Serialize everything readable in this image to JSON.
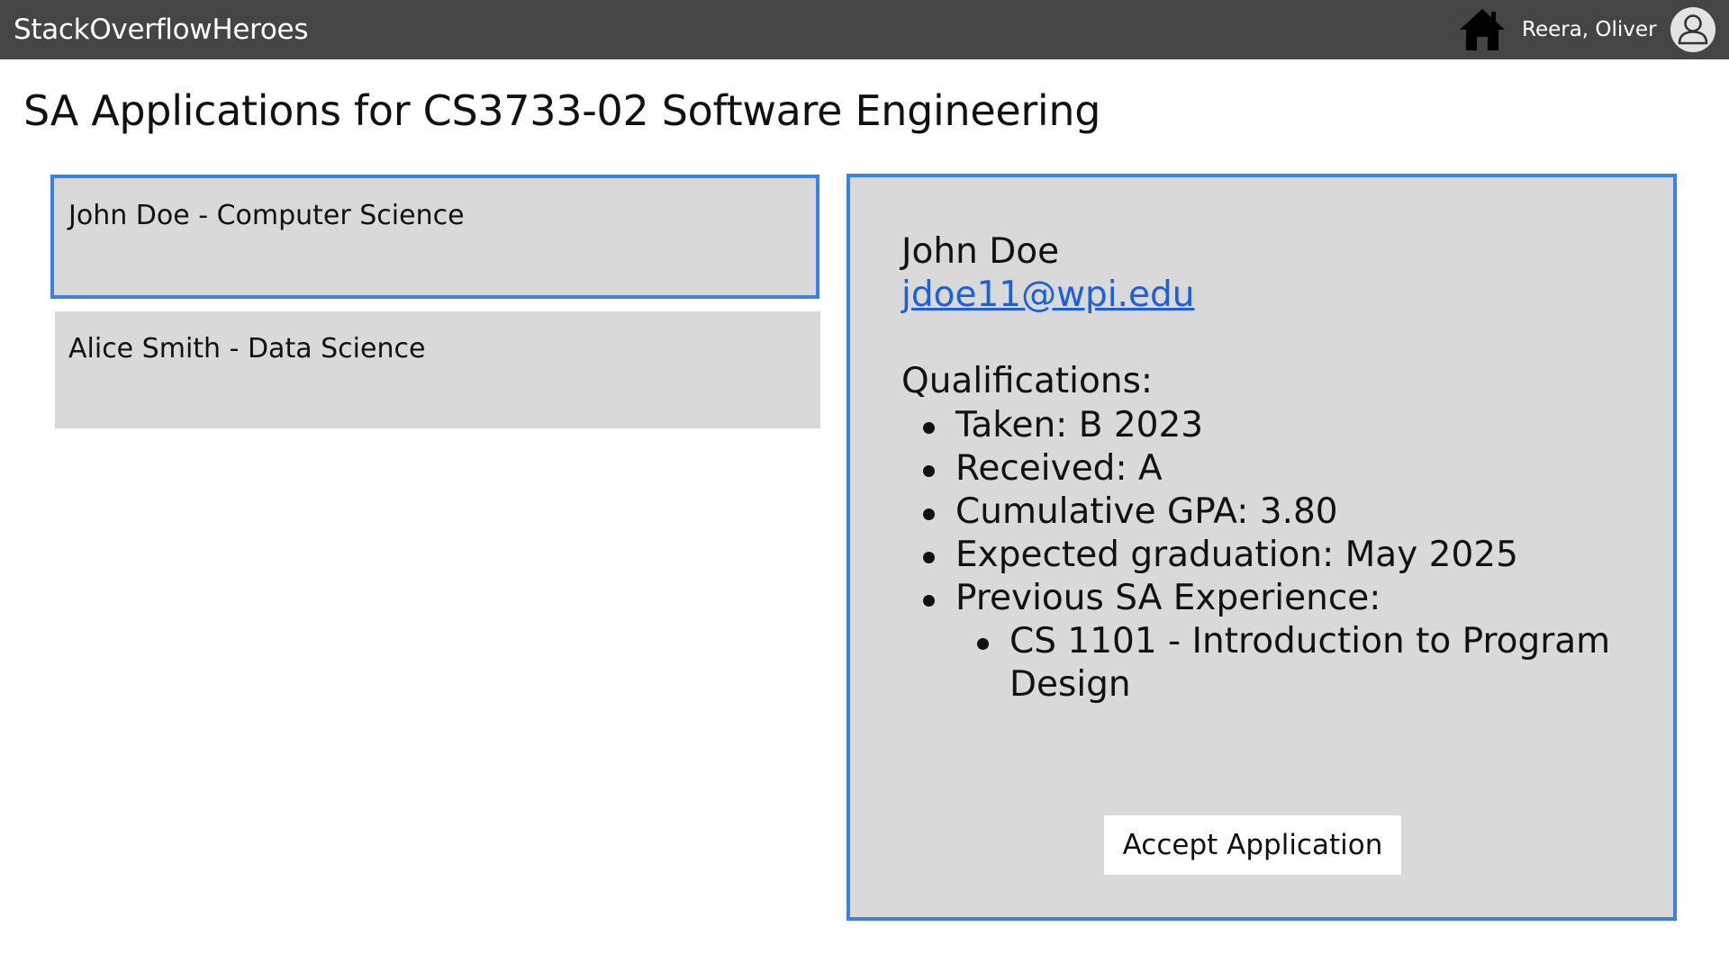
{
  "header": {
    "app_title": "StackOverflowHeroes",
    "user_name": "Reera, Oliver",
    "icons": {
      "home": "home-icon",
      "avatar": "user-avatar-icon"
    },
    "colors": {
      "bar": "#454545",
      "text": "#ffffff"
    }
  },
  "page": {
    "title": "SA Applications for CS3733-02 Software Engineering"
  },
  "applications": [
    {
      "label": "John Doe - Computer Science",
      "selected": true
    },
    {
      "label": "Alice Smith - Data Science",
      "selected": false
    }
  ],
  "detail": {
    "name": "John Doe",
    "email": "jdoe11@wpi.edu",
    "qualifications_heading": "Qualifications:",
    "qualifications": [
      "Taken: B 2023",
      "Received: A",
      "Cumulative GPA: 3.80",
      "Expected graduation: May 2025",
      "Previous SA Experience:"
    ],
    "previous_experience": [
      "CS 1101 - Introduction to Program Design"
    ],
    "accept_label": "Accept Application"
  },
  "colors": {
    "accent": "#3b82e6",
    "panel_bg": "#d9d9d9",
    "link": "#1a5fe0"
  }
}
